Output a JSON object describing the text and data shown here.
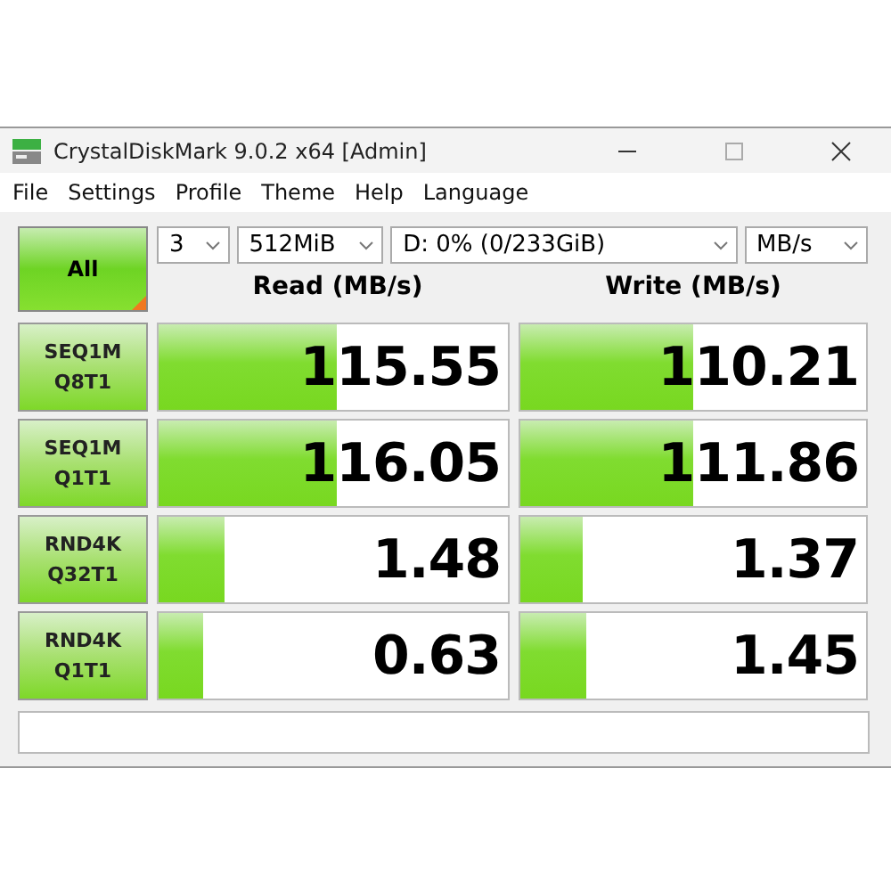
{
  "window": {
    "title": "CrystalDiskMark 9.0.2 x64 [Admin]"
  },
  "menu": [
    "File",
    "Settings",
    "Profile",
    "Theme",
    "Help",
    "Language"
  ],
  "all_button": "All",
  "selectors": {
    "count": "3",
    "size": "512MiB",
    "drive": "D: 0% (0/233GiB)",
    "unit": "MB/s"
  },
  "columns": [
    "Read (MB/s)",
    "Write (MB/s)"
  ],
  "tests": [
    {
      "label": [
        "SEQ1M",
        "Q8T1"
      ],
      "read": {
        "value": "115.55",
        "level": 0.51
      },
      "write": {
        "value": "110.21",
        "level": 0.5
      }
    },
    {
      "label": [
        "SEQ1M",
        "Q1T1"
      ],
      "read": {
        "value": "116.05",
        "level": 0.51
      },
      "write": {
        "value": "111.86",
        "level": 0.5
      }
    },
    {
      "label": [
        "RND4K",
        "Q32T1"
      ],
      "read": {
        "value": "1.48",
        "level": 0.19
      },
      "write": {
        "value": "1.37",
        "level": 0.18
      }
    },
    {
      "label": [
        "RND4K",
        "Q1T1"
      ],
      "read": {
        "value": "0.63",
        "level": 0.13
      },
      "write": {
        "value": "1.45",
        "level": 0.19
      }
    }
  ]
}
